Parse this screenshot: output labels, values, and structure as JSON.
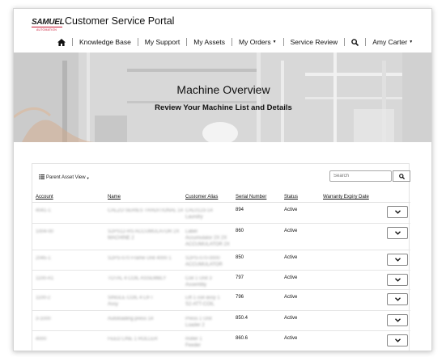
{
  "header": {
    "logo_text": "SAMUEL",
    "logo_subtext": "AUTOMATION",
    "title": "Customer Service Portal"
  },
  "nav": {
    "home_icon": "home-icon",
    "items": [
      {
        "label": "Knowledge Base"
      },
      {
        "label": "My Support"
      },
      {
        "label": "My Assets"
      },
      {
        "label": "My Orders"
      },
      {
        "label": "Service Review"
      }
    ],
    "search_icon": "search-icon",
    "user_name": "Amy Carter"
  },
  "hero": {
    "title": "Machine Overview",
    "subtitle": "Review Your Machine List and Details"
  },
  "toolbar": {
    "view_label": "Parent Asset View",
    "search_placeholder": "Search"
  },
  "table": {
    "columns": {
      "account": "Account",
      "name": "Name",
      "alias": "Customer Alias",
      "serial": "Serial Number",
      "status": "Status",
      "warranty": "Warranty Expiry Date"
    },
    "rows": [
      {
        "account": "4041-1",
        "name": "CALZO SERIES TRADITIONAL 14",
        "alias": [
          "CAL0123-14",
          "Laundry"
        ],
        "serial": "894",
        "status": "Active",
        "warranty": ""
      },
      {
        "account": "1004-00",
        "name": [
          "S2PS12-RS ACCUMULATOR 2X",
          "MACHINE 2"
        ],
        "alias": [
          "Label",
          "Accumulator 2X 2X",
          "ACCUMULATOR 2X"
        ],
        "serial": "860",
        "status": "Active",
        "warranty": ""
      },
      {
        "account": "2045-1",
        "name": "S2PS-070 Frame Unit 4000 1",
        "alias": [
          "S2PS-070-0000",
          "ACCUMULATOR"
        ],
        "serial": "850",
        "status": "Active",
        "warranty": ""
      },
      {
        "account": "1100-A1",
        "name": "TOTAL 4 COIL ASSEMBLY",
        "alias": [
          "Coil 1 Unit 3",
          "Assembly"
        ],
        "serial": "797",
        "status": "Active",
        "warranty": ""
      },
      {
        "account": "1100-2",
        "name": [
          "SINGLE COIL 4 LIFT",
          "Assy"
        ],
        "alias": [
          "Lift 1 coil assy 1",
          "S2-ATT-COIL"
        ],
        "serial": "796",
        "status": "Active",
        "warranty": ""
      },
      {
        "account": "3-1000",
        "name": "Autoloading press 14",
        "alias": [
          "Press 1 Unit",
          "Loader 2"
        ],
        "serial": "850.4",
        "status": "Active",
        "warranty": ""
      },
      {
        "account": "4000",
        "name": "FEED LINE 1 ROLLER",
        "alias": [
          "Roller 1",
          "Feeder"
        ],
        "serial": "860.6",
        "status": "Active",
        "warranty": ""
      }
    ]
  },
  "colors": {
    "logo_red": "#c8102e",
    "text": "#111111",
    "border": "#e3e3e3"
  }
}
